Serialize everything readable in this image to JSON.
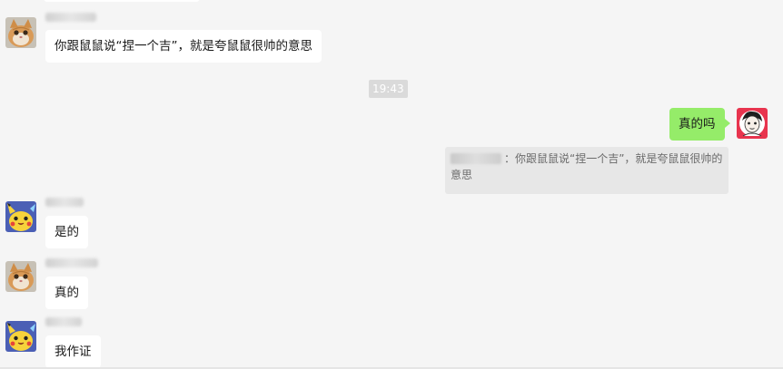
{
  "messages": [
    {
      "sender": "cat",
      "text": "你跟鼠鼠说“捏一个吉”，就是夸鼠鼠很帅的意思"
    },
    {
      "type": "time",
      "text": "19:43"
    },
    {
      "sender": "me",
      "text": "真的吗"
    },
    {
      "quote": {
        "text": "：你跟鼠鼠说“捏一个吉”，就是夸鼠鼠很帅的意思"
      }
    },
    {
      "sender": "pikachu",
      "text": "是的"
    },
    {
      "sender": "cat",
      "text": "真的"
    },
    {
      "sender": "pikachu",
      "text": "我作证"
    }
  ],
  "icons": [
    "avatar-cat",
    "avatar-self",
    "avatar-pikachu"
  ],
  "colors": {
    "background": "#f5f5f5",
    "incoming_bubble": "#ffffff",
    "outgoing_bubble": "#95ec69",
    "time_badge": "#dadada",
    "quote_bg": "#e7e7e7"
  }
}
